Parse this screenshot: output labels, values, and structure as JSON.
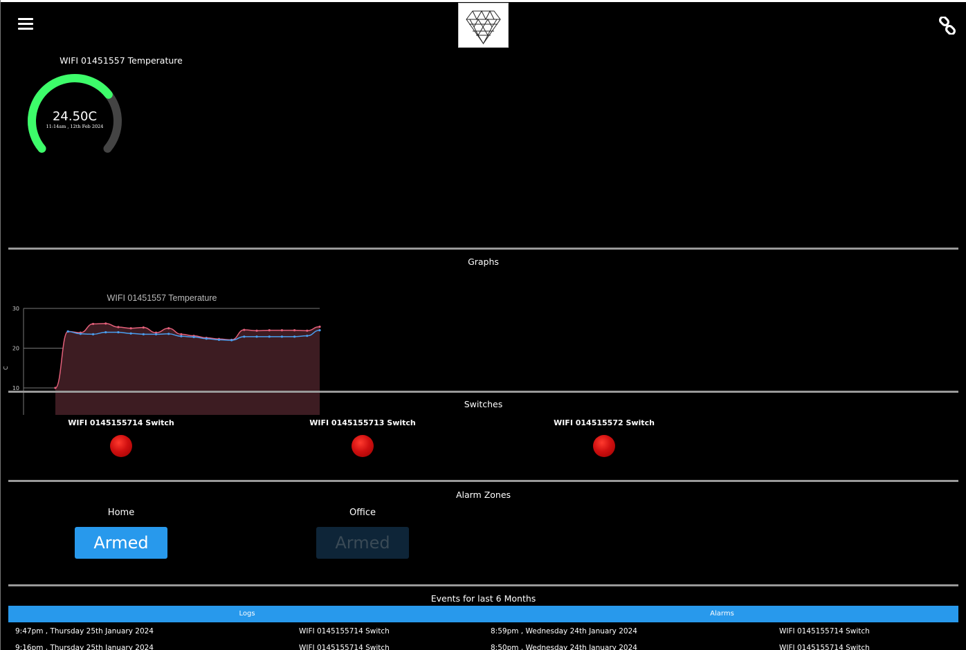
{
  "header": {
    "menu_icon": "hamburger-menu-icon",
    "logo_icon": "diamond-logo-icon",
    "link_icon": "chain-link-icon"
  },
  "gauge": {
    "title": "WIFI 01451557 Temperature",
    "value": "24.50C",
    "timestamp": "11:14am , 12th Feb 2024",
    "fill_fraction": 0.7,
    "color": "#3dfc6a",
    "track_color": "#444444"
  },
  "graphs": {
    "title": "Graphs"
  },
  "chart_data": {
    "type": "area",
    "title": "WIFI 01451557 Temperature",
    "ylabel": "C",
    "ylim": [
      10,
      30
    ],
    "yticks": [
      10,
      20,
      30
    ],
    "grid": true,
    "series": [
      {
        "color": "#e4607a",
        "fill": "#3d1c22",
        "values": [
          10,
          24.2,
          23.9,
          26.1,
          26.2,
          25.3,
          25.0,
          25.2,
          23.9,
          25.0,
          23.5,
          23.1,
          22.6,
          22.3,
          22.1,
          24.6,
          24.4,
          24.5,
          24.5,
          24.5,
          24.4,
          25.4
        ]
      },
      {
        "color": "#4a9ff0",
        "values": [
          null,
          24.2,
          23.6,
          23.5,
          24.0,
          24.0,
          23.7,
          23.5,
          23.5,
          23.6,
          23.0,
          22.8,
          22.4,
          22.1,
          22.0,
          22.9,
          22.9,
          22.9,
          22.9,
          22.9,
          23.1,
          24.5
        ]
      }
    ]
  },
  "switches": {
    "title": "Switches",
    "items": [
      {
        "label": "WIFI 0145155714 Switch",
        "state_color": "#d01010"
      },
      {
        "label": "WIFI 0145155713 Switch",
        "state_color": "#d01010"
      },
      {
        "label": "WIFI 014515572 Switch",
        "state_color": "#d01010"
      }
    ]
  },
  "alarm_zones": {
    "title": "Alarm Zones",
    "zones": [
      {
        "name": "Home",
        "button": "Armed",
        "active": true
      },
      {
        "name": "Office",
        "button": "Armed",
        "active": false
      }
    ]
  },
  "events": {
    "title": "Events for last 6 Months",
    "logs_header": "Logs",
    "alarms_header": "Alarms",
    "logs": [
      {
        "time": "9:47pm , Thursday 25th January 2024",
        "source": "WIFI 0145155714 Switch"
      },
      {
        "time": "9:16pm , Thursday 25th January 2024",
        "source": "WIFI 0145155714 Switch"
      }
    ],
    "alarms": [
      {
        "time": "8:59pm , Wednesday 24th January 2024",
        "source": "WIFI 0145155714 Switch"
      },
      {
        "time": "8:50pm , Wednesday 24th January 2024",
        "source": "WIFI 0145155714 Switch"
      }
    ]
  },
  "colors": {
    "accent": "#2899ec",
    "divider": "#999999",
    "background": "#000000"
  }
}
